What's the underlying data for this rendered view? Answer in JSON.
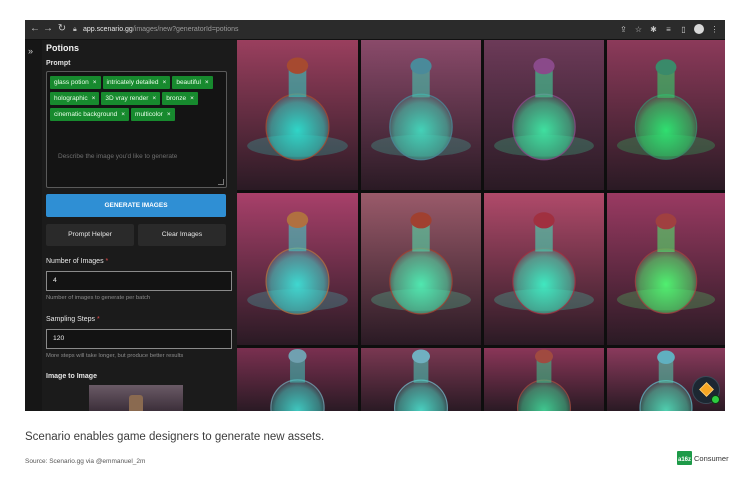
{
  "browser": {
    "url_host": "app.scenario.gg",
    "url_path": "/images/new?generatorId=potions",
    "icons": [
      "back-icon",
      "forward-icon",
      "reload-icon",
      "lock-icon",
      "share-icon",
      "star-icon",
      "extension-icon",
      "media-icon",
      "sidepanel-icon",
      "profile-icon",
      "more-icon"
    ]
  },
  "sidebar": {
    "rail_icon": "»",
    "title": "Potions",
    "prompt_label": "Prompt",
    "tags": [
      "glass potion",
      "intricately detailed",
      "beautiful",
      "holographic",
      "3D vray render",
      "bronze",
      "cinematic background",
      "multicolor"
    ],
    "tag_close": "×",
    "prompt_placeholder": "Describe the image you'd like to generate",
    "generate_label": "GENERATE IMAGES",
    "prompt_helper_label": "Prompt Helper",
    "clear_images_label": "Clear Images",
    "num_images_label": "Number of Images",
    "num_images_value": "4",
    "num_images_help": "Number of images to generate per batch",
    "sampling_label": "Sampling Steps",
    "sampling_value": "120",
    "sampling_help": "More steps will take longer, but produce better results",
    "required_mark": "*",
    "image_to_image_label": "Image to Image"
  },
  "gallery": {
    "tiles": [
      {
        "bg": "#9a3f5e",
        "glow": "#2fd6c8",
        "cap": "#a64a30"
      },
      {
        "bg": "#8a4a6a",
        "glow": "#44d2b8",
        "cap": "#4a8a9a"
      },
      {
        "bg": "#6c3a58",
        "glow": "#3fe0a0",
        "cap": "#8a4a8a"
      },
      {
        "bg": "#8c3a5a",
        "glow": "#2fe070",
        "cap": "#3a8a6a"
      },
      {
        "bg": "#a8406a",
        "glow": "#3fd8d0",
        "cap": "#b07040"
      },
      {
        "bg": "#9a5a6a",
        "glow": "#50e8b0",
        "cap": "#a04030"
      },
      {
        "bg": "#b04a6a",
        "glow": "#40e8c0",
        "cap": "#a03040"
      },
      {
        "bg": "#9a3a62",
        "glow": "#50f070",
        "cap": "#a04040"
      },
      {
        "bg": "#7a3050",
        "glow": "#40c8c0",
        "cap": "#70a0b0"
      },
      {
        "bg": "#7a3852",
        "glow": "#4ad0c0",
        "cap": "#70b0c0"
      },
      {
        "bg": "#8a3658",
        "glow": "#40c890",
        "cap": "#a04a40"
      },
      {
        "bg": "#8a3a5c",
        "glow": "#50d0b0",
        "cap": "#60b0c0"
      }
    ]
  },
  "fab_icon": "cube-assistant-icon",
  "caption": "Scenario enables game designers to generate new assets.",
  "source": "Source: Scenario.gg via @emmanuel_2m",
  "brand": {
    "logo": "a16z",
    "name": "Consumer",
    "color": "#1d9a48"
  }
}
